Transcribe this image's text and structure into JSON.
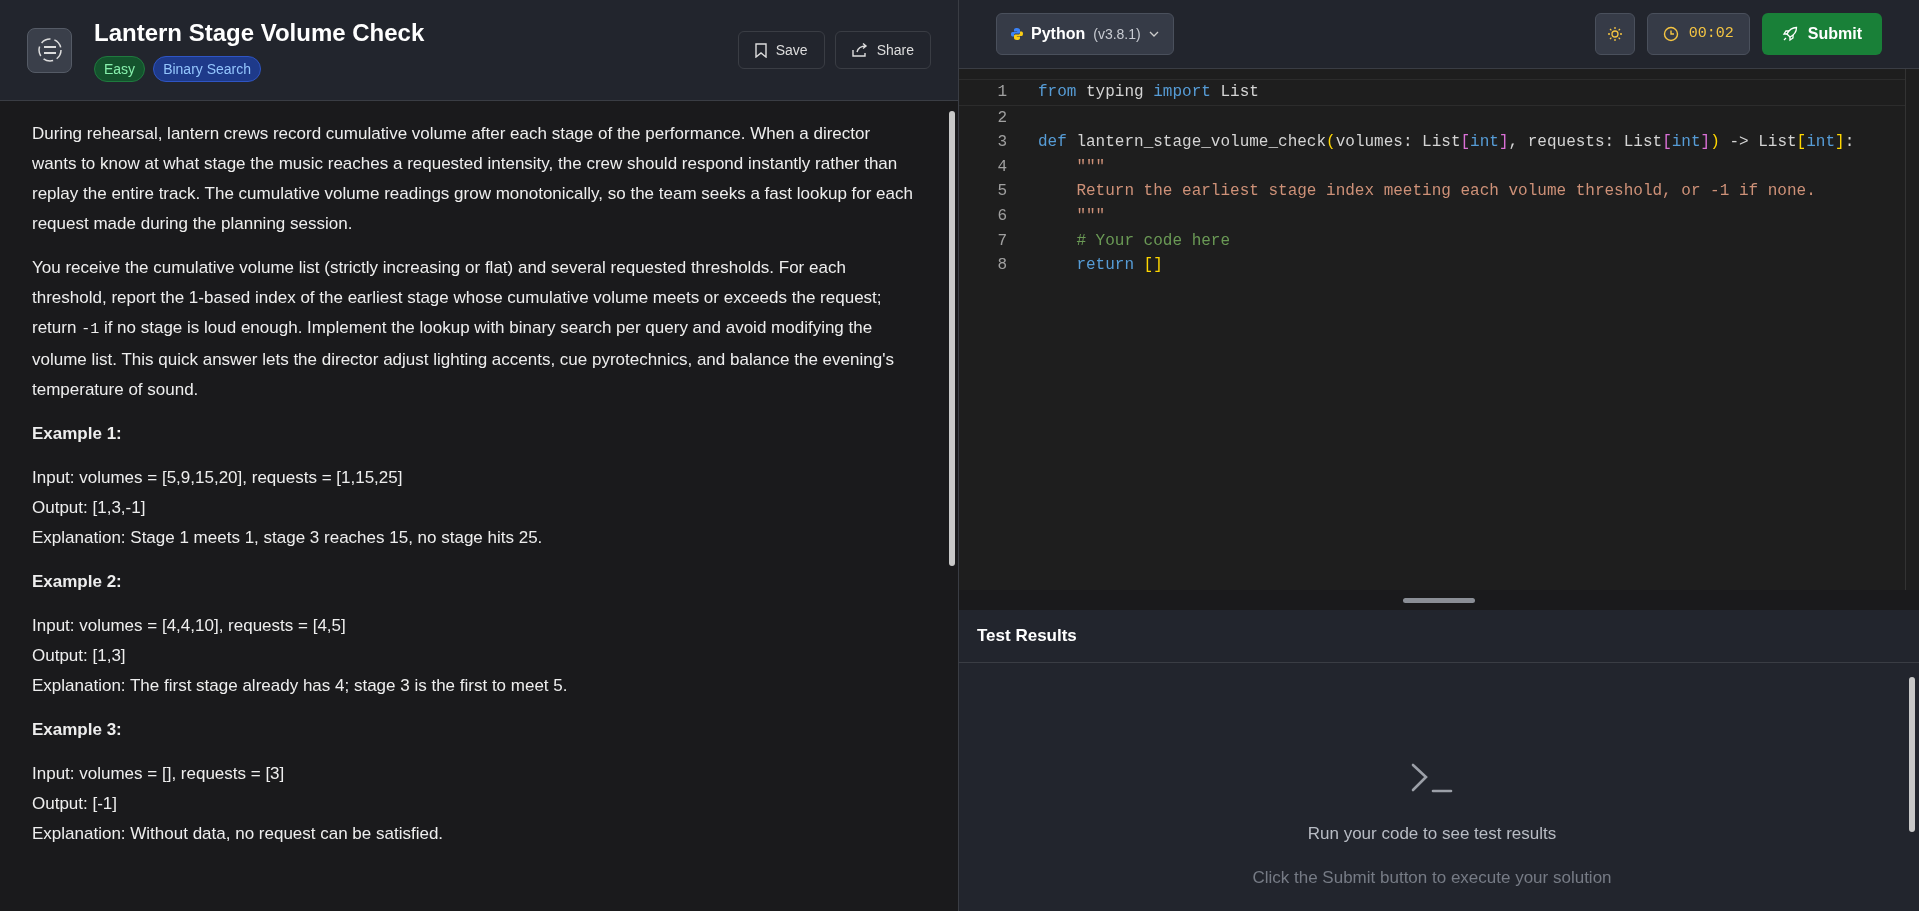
{
  "problem": {
    "title": "Lantern Stage Volume Check",
    "tags": [
      {
        "label": "Easy",
        "kind": "difficulty"
      },
      {
        "label": "Binary Search",
        "kind": "topic"
      }
    ],
    "actions": [
      {
        "label": "Save",
        "kind": "save"
      },
      {
        "label": "Share",
        "kind": "share"
      }
    ]
  },
  "description": [
    {
      "kind": "paragraph",
      "parts": [
        {
          "text": "During rehearsal, lantern crews record cumulative volume after each stage of the performance. When a director wants to know at what stage the music reaches a requested intensity, the crew should respond instantly rather than replay the entire track. The cumulative volume readings grow monotonically, so the team seeks a fast lookup for each request made during the planning session."
        }
      ]
    },
    {
      "kind": "paragraph",
      "parts": [
        {
          "text": "You receive the cumulative volume list (strictly increasing or flat) and several requested thresholds. For each threshold, report the 1-based index of the earliest stage whose cumulative volume meets or exceeds the request; return "
        },
        {
          "text": "-1",
          "kind": "code"
        },
        {
          "text": " if no stage is loud enough. Implement the lookup with binary search per query and avoid modifying the volume list. This quick answer lets the director adjust lighting accents, cue pyrotechnics, and balance the evening's temperature of sound."
        }
      ]
    },
    {
      "kind": "heading",
      "text": "Example 1:"
    },
    {
      "kind": "example",
      "lines": [
        "Input: volumes = [5,9,15,20], requests = [1,15,25]",
        "Output: [1,3,-1]",
        "Explanation: Stage 1 meets 1, stage 3 reaches 15, no stage hits 25."
      ]
    },
    {
      "kind": "heading",
      "text": "Example 2:"
    },
    {
      "kind": "example",
      "lines": [
        "Input: volumes = [4,4,10], requests = [4,5]",
        "Output: [1,3]",
        "Explanation: The first stage already has 4; stage 3 is the first to meet 5."
      ]
    },
    {
      "kind": "heading",
      "text": "Example 3:"
    },
    {
      "kind": "example",
      "lines": [
        "Input: volumes = [], requests = [3]",
        "Output: [-1]",
        "Explanation: Without data, no request can be satisfied."
      ]
    }
  ],
  "toolbar": {
    "language": "Python",
    "version": "(v3.8.1)",
    "timer": "00:02",
    "submit": "Submit"
  },
  "editor": {
    "lines": [
      {
        "number": "1",
        "tokens": [
          {
            "kind": "kw",
            "text": "from"
          },
          {
            "kind": "plain",
            "text": " typing "
          },
          {
            "kind": "kw",
            "text": "import"
          },
          {
            "kind": "plain",
            "text": " List"
          }
        ]
      },
      {
        "number": "2"
      },
      {
        "number": "3",
        "tokens": [
          {
            "kind": "kw",
            "text": "def"
          },
          {
            "kind": "plain",
            "text": " lantern_stage_volume_check"
          },
          {
            "kind": "b1",
            "text": "("
          },
          {
            "kind": "plain",
            "text": "volumes: List"
          },
          {
            "kind": "b2",
            "text": "["
          },
          {
            "kind": "kw",
            "text": "int"
          },
          {
            "kind": "b2",
            "text": "]"
          },
          {
            "kind": "plain",
            "text": ", requests: List"
          },
          {
            "kind": "b2",
            "text": "["
          },
          {
            "kind": "kw",
            "text": "int"
          },
          {
            "kind": "b2",
            "text": "]"
          },
          {
            "kind": "b1",
            "text": ")"
          },
          {
            "kind": "plain",
            "text": " -> List"
          },
          {
            "kind": "b1",
            "text": "["
          },
          {
            "kind": "kw",
            "text": "int"
          },
          {
            "kind": "b1",
            "text": "]"
          },
          {
            "kind": "plain",
            "text": ":"
          }
        ]
      },
      {
        "number": "4",
        "tokens": [
          {
            "kind": "str",
            "text": "    \"\"\""
          }
        ]
      },
      {
        "number": "5",
        "tokens": [
          {
            "kind": "str",
            "text": "    Return the earliest stage index meeting each volume threshold, or -1 if none."
          }
        ]
      },
      {
        "number": "6",
        "tokens": [
          {
            "kind": "str",
            "text": "    \"\"\""
          }
        ]
      },
      {
        "number": "7",
        "tokens": [
          {
            "kind": "comment",
            "text": "    # Your code here"
          }
        ]
      },
      {
        "number": "8",
        "tokens": [
          {
            "kind": "kw",
            "text": "    return"
          },
          {
            "kind": "b1",
            "text": " []"
          }
        ]
      }
    ]
  },
  "results": {
    "title": "Test Results",
    "empty_title": "Run your code to see test results",
    "empty_hint": "Click the Submit button to execute your solution"
  }
}
